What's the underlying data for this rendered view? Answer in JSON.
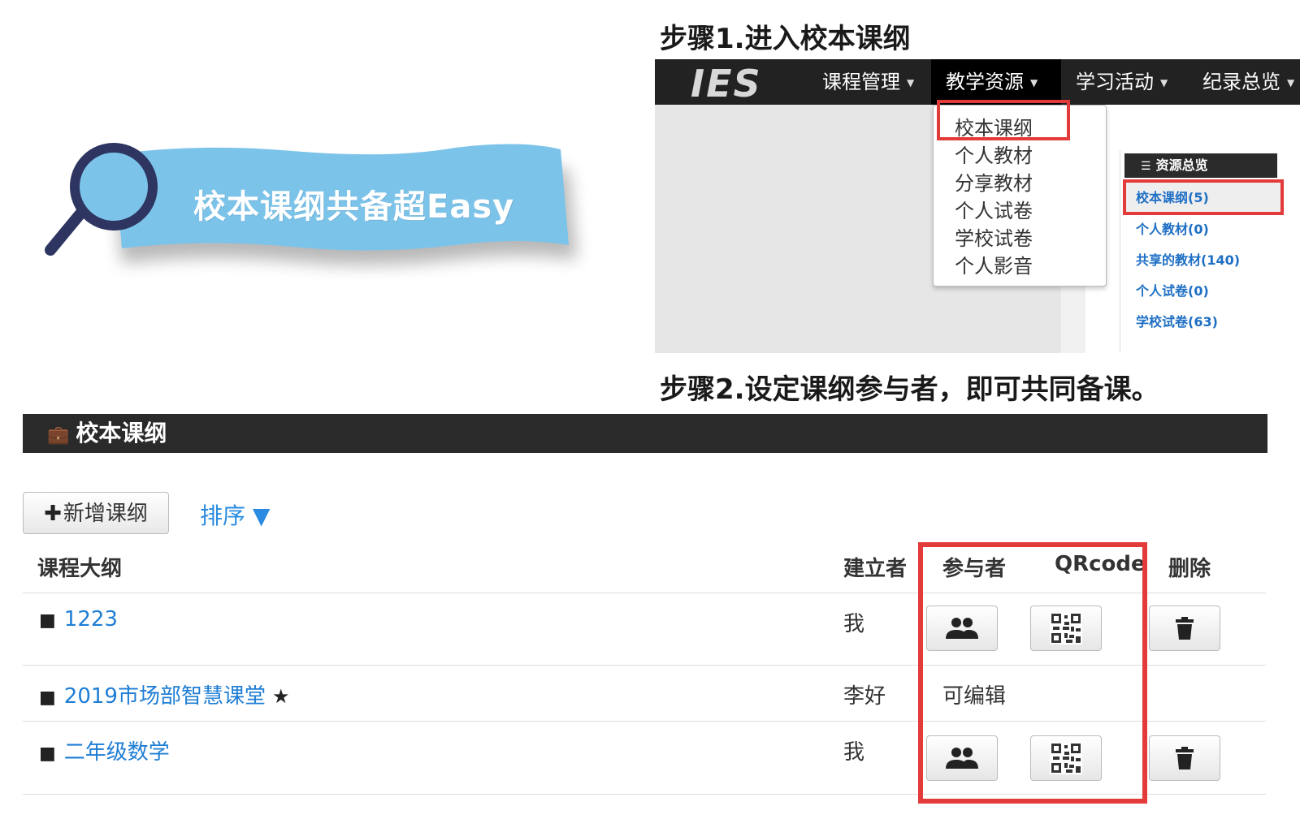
{
  "banner": {
    "title": "校本课纲共备超Easy",
    "colors": {
      "ribbon": "#7cc3ea",
      "magnifier_ring": "#2d3560",
      "magnifier_lens": "#7cc3ea"
    }
  },
  "step1": {
    "title": "步骤1.进入校本课纲",
    "logo": "IES",
    "nav": [
      "课程管理",
      "教学资源",
      "学习活动",
      "纪录总览"
    ],
    "dropdown": [
      "校本课纲",
      "个人教材",
      "分享教材",
      "个人试卷",
      "学校试卷",
      "个人影音"
    ],
    "panel": {
      "header": "资源总览",
      "links": [
        "校本课纲(5)",
        "个人教材(0)",
        "共享的教材(140)",
        "个人试卷(0)",
        "学校试卷(63)"
      ]
    }
  },
  "step2": {
    "title": "步骤2.设定课纲参与者，即可共同备课。",
    "section_title": "校本课纲",
    "add_button": "新增课纲",
    "sort_label": "排序 ▼",
    "columns": {
      "title": "课程大纲",
      "creator": "建立者",
      "members": "参与者",
      "qrcode": "QRcode",
      "delete": "删除"
    },
    "rows": [
      {
        "title": "1223",
        "creator": "我"
      },
      {
        "title": "2019市场部智慧课堂",
        "creator": "李好",
        "note": "可编辑"
      },
      {
        "title": "二年级数学",
        "creator": "我"
      }
    ]
  },
  "colors": {
    "highlight_red": "#e33a3a",
    "link_blue": "#1e7dd4",
    "header_dark": "#2a2a2a"
  }
}
